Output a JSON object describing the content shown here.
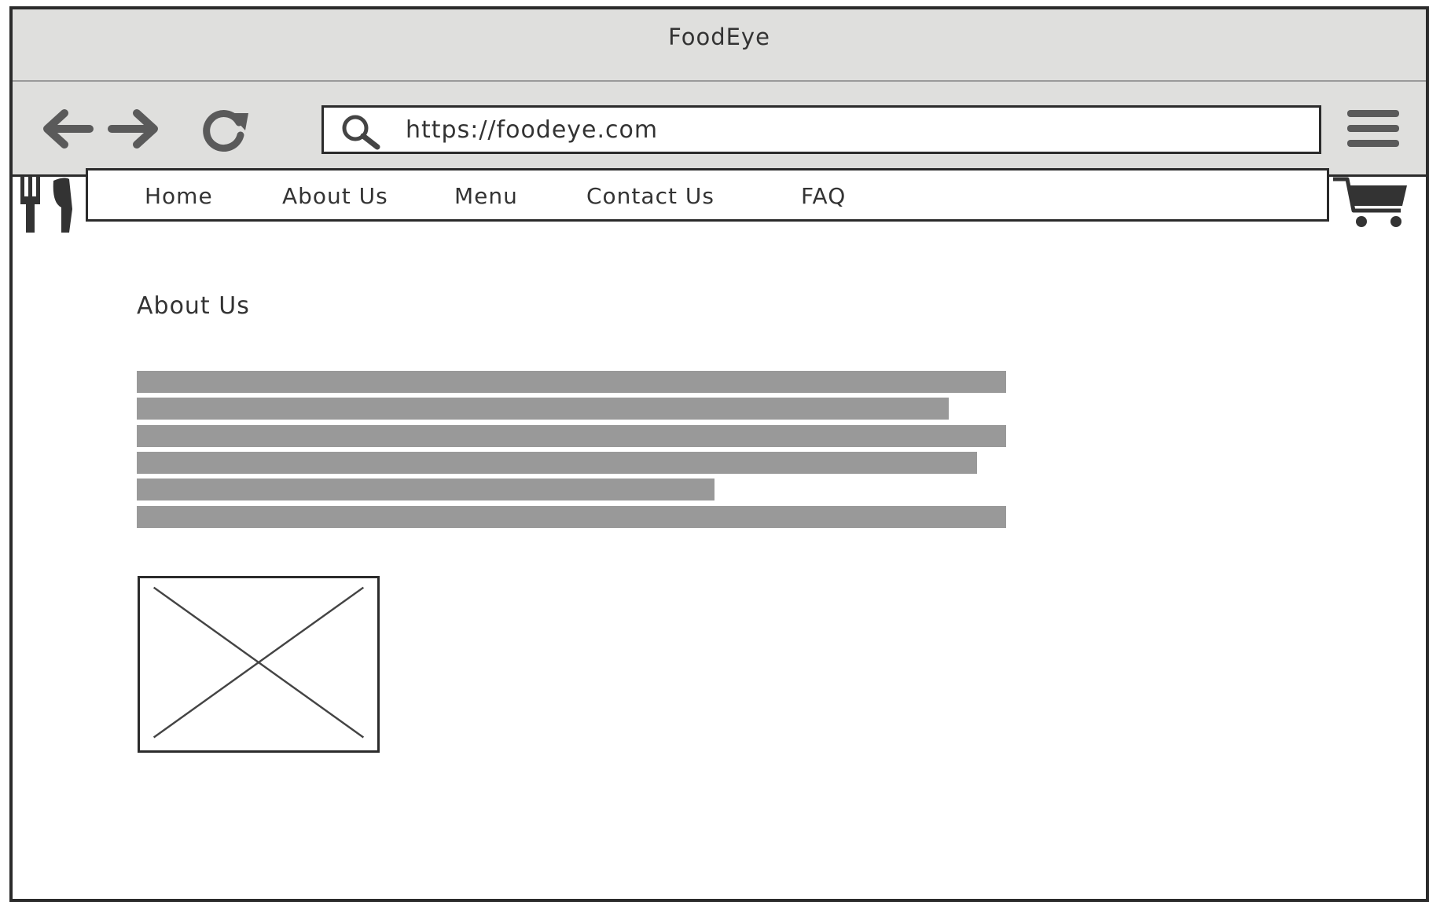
{
  "window": {
    "title": "FoodEye"
  },
  "toolbar": {
    "back_icon": "back-arrow-icon",
    "forward_icon": "forward-arrow-icon",
    "reload_icon": "reload-icon",
    "url": "https://foodeye.com",
    "search_icon": "search-icon",
    "menu_icon": "hamburger-menu-icon"
  },
  "site": {
    "logo_icon": "fork-knife-icon",
    "nav_items": [
      {
        "label": "Home"
      },
      {
        "label": "About Us"
      },
      {
        "label": "Menu"
      },
      {
        "label": "Contact Us"
      },
      {
        "label": "FAQ"
      }
    ],
    "cart_icon": "shopping-cart-icon"
  },
  "main": {
    "heading": "About Us",
    "text_placeholder_lines": 6,
    "image_placeholder_icon": "image-placeholder-icon"
  },
  "colors": {
    "chrome": "#dfdfdd",
    "border": "#2b2b2b",
    "text_placeholder": "#999999",
    "icon": "#5a5a5a"
  }
}
